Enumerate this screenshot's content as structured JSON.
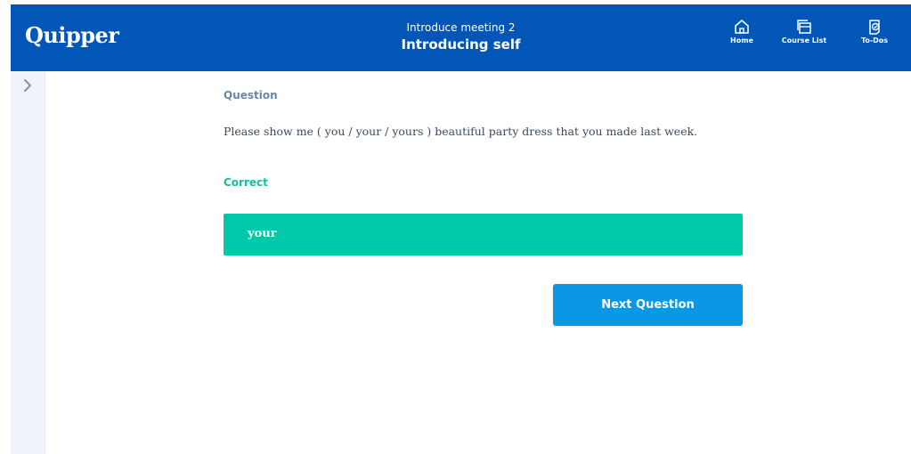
{
  "header": {
    "logo": "Quipper",
    "subtitle": "Introduce meeting 2",
    "title": "Introducing self",
    "nav": [
      {
        "label": "Home",
        "icon": "home-icon"
      },
      {
        "label": "Course List",
        "icon": "course-list-icon"
      },
      {
        "label": "To-Dos",
        "icon": "todos-icon"
      }
    ]
  },
  "sidebar": {
    "toggle_icon": "chevron-right-icon"
  },
  "main": {
    "question_label": "Question",
    "question_text": "Please show me ( you / your / yours ) beautiful party dress that you made last week.",
    "result_label": "Correct",
    "answer": "your",
    "next_button": "Next Question"
  },
  "colors": {
    "header_bg": "#0156b8",
    "correct_green": "#00c9ab",
    "button_blue": "#0a98e6",
    "label_gray_blue": "#6b86a8"
  }
}
